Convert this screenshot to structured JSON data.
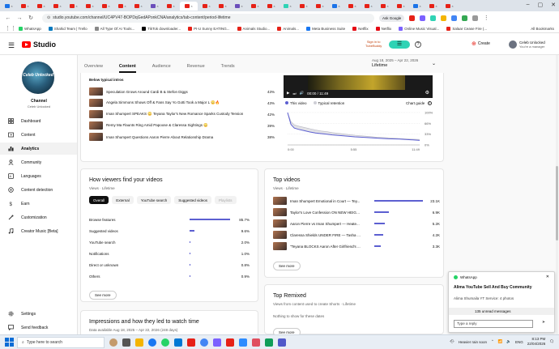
{
  "browser": {
    "url": "studio.youtube.com/channel/UC4PV47-BOPDqGedAPonkCNA/analytics/tab-content/period-lifetime",
    "ask_google": "Ask Google",
    "bookmarks": [
      "WhatsApp",
      "Shahid Team | Trello",
      "All Type Of AI Tools...",
      "TikTok downloader...",
      "PI-U Sunny EATING...",
      "Animals Studio...",
      "Animals...",
      "Meta Business Suite",
      "Netflix",
      "Netflix",
      "Online Music Visual...",
      "Salaar Cease Fire (..."
    ],
    "all_bookmarks": "All Bookmarks"
  },
  "header": {
    "logo_text": "Studio",
    "signin": "Sign in to",
    "signin2": "TubeBuddy",
    "create": "Create",
    "account_name": "Celeb Unlocked",
    "account_sub": "You're a manager"
  },
  "sidebar": {
    "channel_label": "Channel",
    "channel_name": "Celeb Unlocked",
    "channel_art_text": "Celeb Unlocked",
    "items": [
      {
        "label": "Dashboard",
        "icon": "dashboard-icon"
      },
      {
        "label": "Content",
        "icon": "content-icon"
      },
      {
        "label": "Analytics",
        "icon": "analytics-icon"
      },
      {
        "label": "Community",
        "icon": "community-icon"
      },
      {
        "label": "Languages",
        "icon": "languages-icon"
      },
      {
        "label": "Content detection",
        "icon": "content-detection-icon"
      },
      {
        "label": "Earn",
        "icon": "earn-icon"
      },
      {
        "label": "Customization",
        "icon": "customization-icon"
      },
      {
        "label": "Creator Music [Beta]",
        "icon": "creator-music-icon"
      }
    ],
    "settings": "Settings",
    "feedback": "Send feedback"
  },
  "tabs": [
    "Overview",
    "Content",
    "Audience",
    "Revenue",
    "Trends"
  ],
  "date_range": {
    "range": "Aug 18, 2025 – Apr 22, 2026",
    "label": "Lifetime"
  },
  "intros": {
    "heading": "Below typical intros",
    "videos": [
      {
        "title": "Speculation Grows Around Cardi B & Stefon Diggs",
        "pct": "43%"
      },
      {
        "title": "Angela Simmons Shows Off & Fans Say Yo Gotti Took a Major L 😳🔥",
        "pct": "43%"
      },
      {
        "title": "Iman Shumpert SPEAKS 😳 Teyana Taylor's New Romance Sparks Custody Tension",
        "pct": "42%"
      },
      {
        "title": "Remy Ma Flaunts Ring Amid Papoose & Claressa Sightings 😳",
        "pct": "39%"
      },
      {
        "title": "Iman Shumpert Questions Aaron Pierre About Relationship Drama",
        "pct": "38%"
      }
    ]
  },
  "player": {
    "time": "00:00 / 11:49",
    "watermark": "Celeb"
  },
  "retention": {
    "legend_this": "This video",
    "legend_typical": "Typical retention",
    "chart_guide": "Chart guide",
    "colors": {
      "this": "#5c5fd1",
      "typical": "#cfcfd6"
    }
  },
  "chart_data": {
    "type": "line",
    "title": "",
    "xlabel": "",
    "ylabel": "",
    "x_ticks": [
      "0:00",
      "5:55",
      "11:49"
    ],
    "y_ticks": [
      "100%",
      "66%",
      "33%",
      "0%"
    ],
    "ylim": [
      0,
      100
    ],
    "x": [
      0,
      0.3,
      0.6,
      1,
      1.5,
      2,
      2.5,
      3,
      3.5,
      4,
      5,
      6,
      7,
      8,
      9,
      10,
      11,
      11.8
    ],
    "series": [
      {
        "values": [
          100,
          63,
          52,
          48,
          44,
          40,
          37,
          35,
          33,
          31,
          28,
          25,
          23,
          21,
          19,
          18,
          16,
          14
        ]
      },
      {
        "values": [
          100,
          72,
          62,
          58,
          54,
          50,
          46,
          43,
          41,
          38,
          34,
          30,
          27,
          24,
          22,
          20,
          18,
          17
        ]
      }
    ]
  },
  "find": {
    "title": "How viewers find your videos",
    "sub": "Views · Lifetime",
    "chips": [
      "Overall",
      "External",
      "YouTube search",
      "Suggested videos",
      "Playlists"
    ],
    "rows": [
      {
        "label": "Browse features",
        "value": "85.7%",
        "pct": 85.7
      },
      {
        "label": "Suggested videos",
        "value": "9.6%",
        "pct": 9.6
      },
      {
        "label": "YouTube search",
        "value": "2.0%",
        "pct": 2.0
      },
      {
        "label": "Notifications",
        "value": "1.0%",
        "pct": 1.0
      },
      {
        "label": "Direct or unknown",
        "value": "0.8%",
        "pct": 0.8
      },
      {
        "label": "Others",
        "value": "0.9%",
        "pct": 0.9
      }
    ],
    "see_more": "See more"
  },
  "top_videos": {
    "title": "Top videos",
    "sub": "Views · Lifetime",
    "rows": [
      {
        "title": "Iman Shumpert Emotional in Court — Tey...",
        "value": "23.1K",
        "pct": 100
      },
      {
        "title": "Taylor's Love Confession ON NEW HEIGH...",
        "value": "6.9K",
        "pct": 30
      },
      {
        "title": "Aaron Pierre vs Iman Shumpert — Heate...",
        "value": "5.2K",
        "pct": 22
      },
      {
        "title": "Claressa Shields UNDER FIRE — Tasha K ...",
        "value": "4.2K",
        "pct": 18
      },
      {
        "title": "\"Teyana BLOCKS Aaron After Girlfriend's ...",
        "value": "3.3K",
        "pct": 14
      }
    ],
    "see_more": "See more"
  },
  "remixed": {
    "title": "Top Remixed",
    "sub": "Views from content used to create Shorts · Lifetime",
    "empty": "Nothing to show for these dates",
    "see_more": "See more"
  },
  "impressions": {
    "title": "Impressions and how they led to watch time",
    "sub": "Data available Aug 18, 2025 – Apr 22, 2026 (248 days)"
  },
  "whatsapp": {
    "app": "WhatsApp",
    "title": "Alima YouTube Sell And Buy Community",
    "sub": "Alima Shumaila YT Service: 4 photos",
    "unread": "135 unread messages",
    "reply_placeholder": "Type a reply"
  },
  "taskbar": {
    "search_placeholder": "Type here to search",
    "weather": "Heavier rain soon",
    "lang": "ENG",
    "time": "8:13 PM",
    "date": "22/04/2026"
  }
}
